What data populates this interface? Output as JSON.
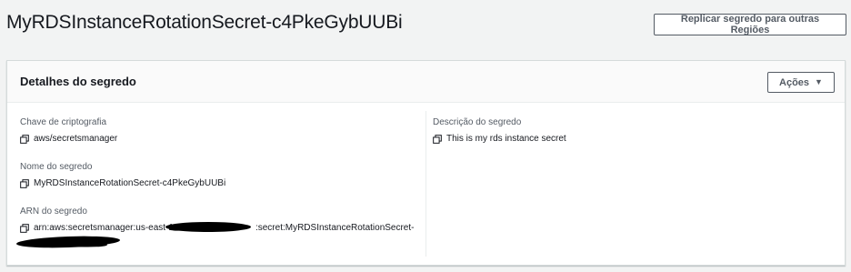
{
  "page": {
    "title": "MyRDSInstanceRotationSecret-c4PkeGybUUBi",
    "replicate_button": "Replicar segredo para outras Regiões"
  },
  "panel": {
    "title": "Detalhes do segredo",
    "actions_button": "Ações",
    "left_fields": [
      {
        "label": "Chave de criptografia",
        "value": "aws/secretsmanager"
      },
      {
        "label": "Nome do segredo",
        "value": "MyRDSInstanceRotationSecret-c4PkeGybUUBi"
      },
      {
        "label": "ARN do segredo",
        "value_prefix": "arn:aws:secretsmanager:us-east-1",
        "value_suffix": ":secret:MyRDSInstanceRotationSecret-"
      }
    ],
    "right_fields": [
      {
        "label": "Descrição do segredo",
        "value": "This is my rds instance secret"
      }
    ]
  },
  "icons": {
    "copy": "copy-icon",
    "actions_caret": "caret-down-icon"
  },
  "colors": {
    "background": "#f2f3f3",
    "panel_header": "#fafafa",
    "button_border": "#545b64",
    "text": "#16191f",
    "label": "#545b64",
    "redaction": "#000000"
  }
}
